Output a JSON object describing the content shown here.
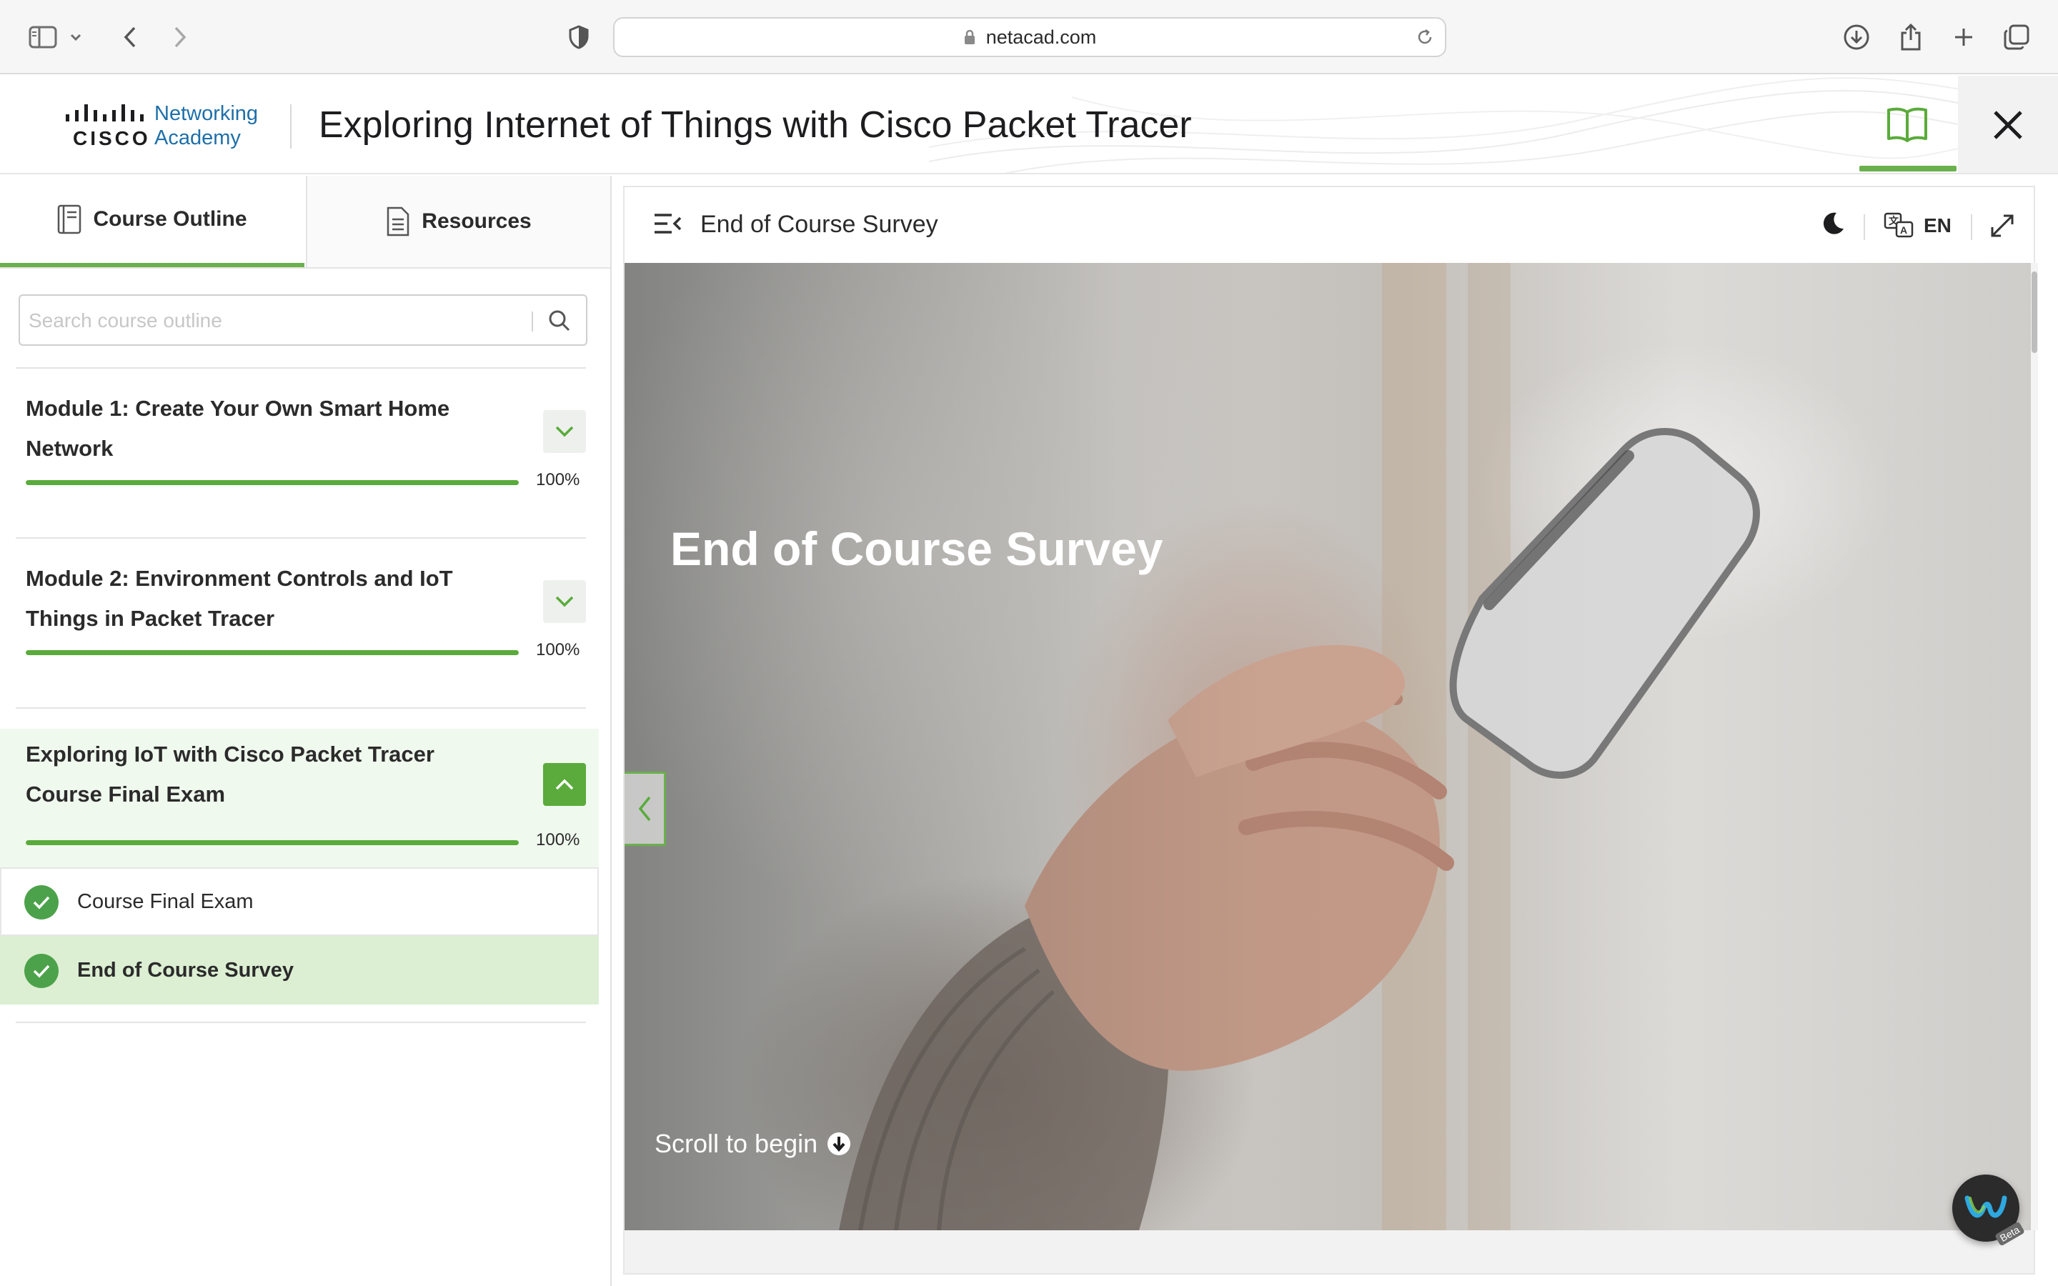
{
  "browser": {
    "url": "netacad.com"
  },
  "header": {
    "brand_top": "Networking",
    "brand_bottom": "Academy",
    "brand_wordmark": "CISCO",
    "course_title": "Exploring Internet of Things with Cisco Packet Tracer"
  },
  "sidebar": {
    "tabs": [
      {
        "label": "Course Outline",
        "icon": "outline-icon",
        "active": true
      },
      {
        "label": "Resources",
        "icon": "document-icon",
        "active": false
      }
    ],
    "search_placeholder": "Search course outline",
    "modules": [
      {
        "title": "Module 1: Create Your Own Smart Home Network",
        "progress": 1.0,
        "progress_text": "100%",
        "expanded": false
      },
      {
        "title": "Module 2: Environment Controls and IoT Things in Packet Tracer",
        "progress": 1.0,
        "progress_text": "100%",
        "expanded": false
      },
      {
        "title": "Exploring IoT with Cisco Packet Tracer Course Final Exam",
        "progress": 1.0,
        "progress_text": "100%",
        "expanded": true
      }
    ],
    "lessons": [
      {
        "title": "Course Final Exam",
        "completed": true,
        "current": false
      },
      {
        "title": "End of Course Survey",
        "completed": true,
        "current": true
      }
    ]
  },
  "content": {
    "page_name": "End of Course Survey",
    "language": "EN",
    "hero_title": "End of Course Survey",
    "scroll_hint": "Scroll to begin"
  },
  "widget": {
    "badge": "Beta"
  },
  "colors": {
    "accent_green": "#6ab04c",
    "progress_green": "#5aab3b",
    "check_green": "#4ca24a",
    "current_lesson_bg": "#dcefd3",
    "cisco_blue": "#1f6fa8"
  }
}
